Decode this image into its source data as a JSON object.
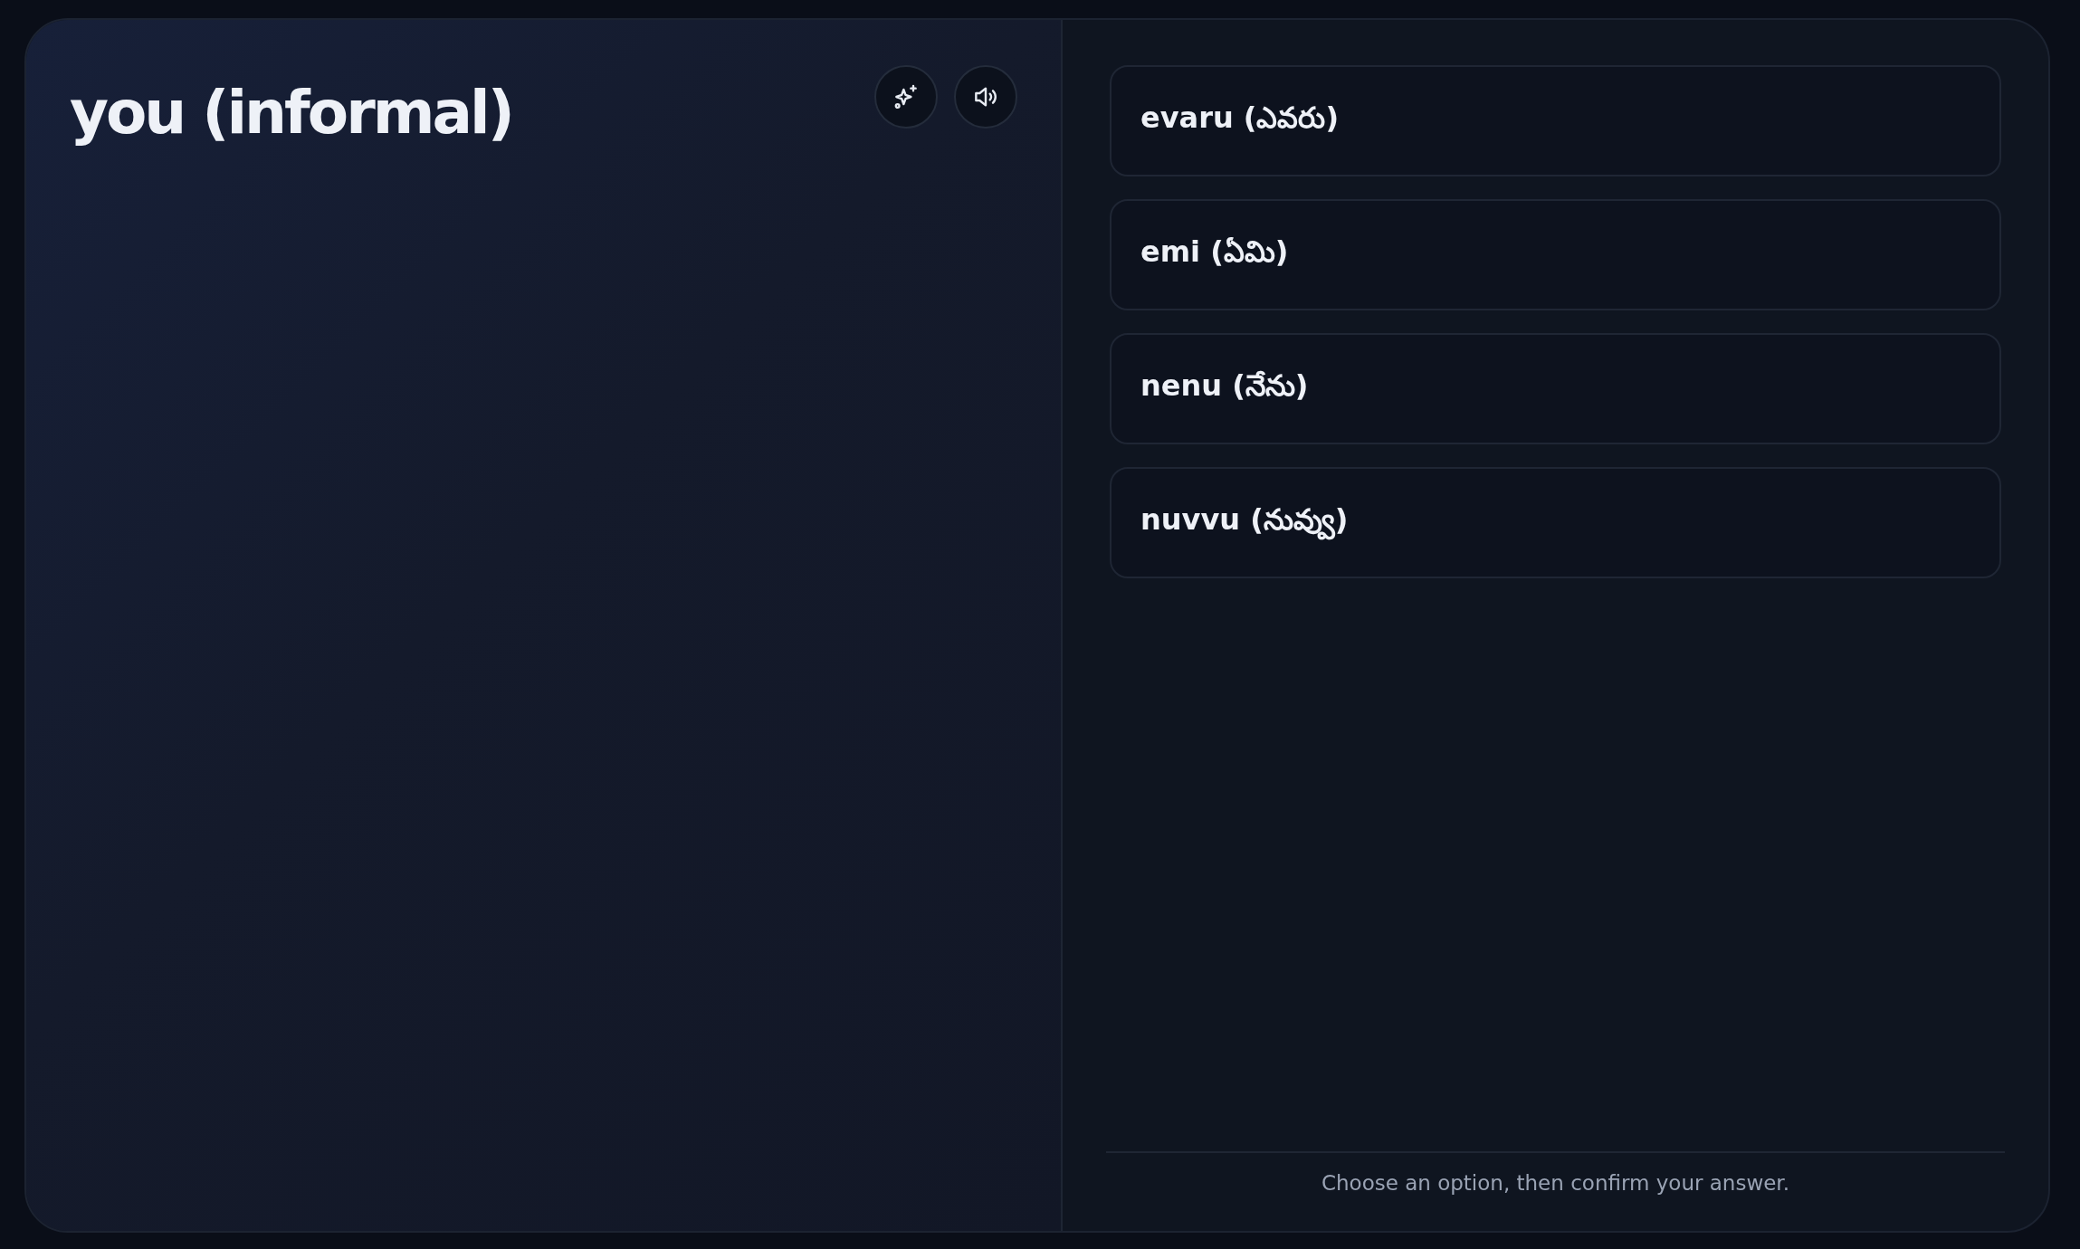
{
  "prompt": {
    "title": "you (informal)"
  },
  "actions": [
    {
      "kind": "sparkle"
    },
    {
      "kind": "speaker"
    }
  ],
  "options": [
    {
      "label": "evaru (ఎవరు)",
      "selected": false
    },
    {
      "label": "emi (ఏమి)",
      "selected": false
    },
    {
      "label": "nenu (నేను)",
      "selected": false
    },
    {
      "label": "nuvvu (నువ్వు)",
      "selected": false
    }
  ],
  "footer": {
    "hint": "Choose an option, then confirm your answer."
  }
}
